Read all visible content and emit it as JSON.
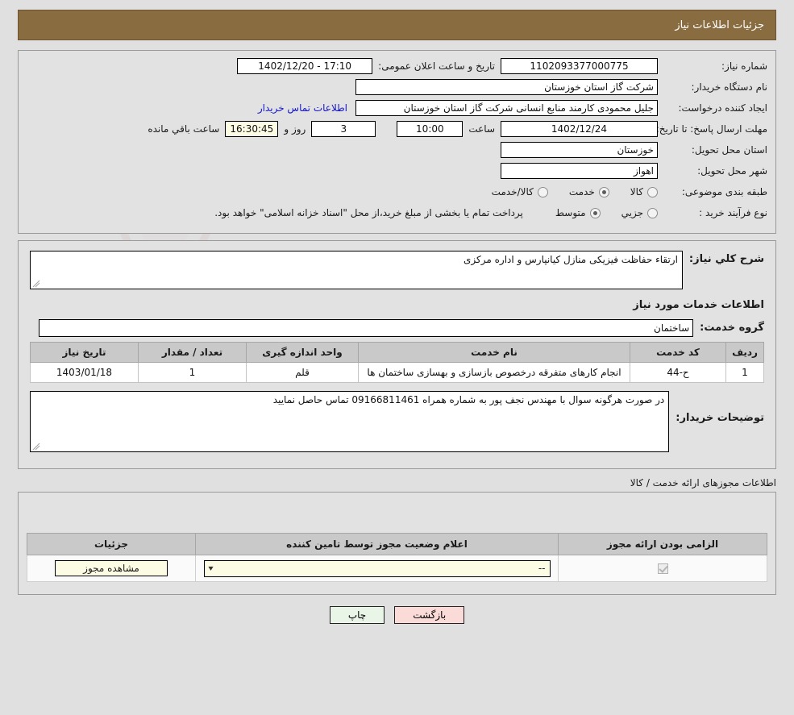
{
  "header": {
    "title": "جزئیات اطلاعات نیاز",
    "bar_color": "#8a6c41"
  },
  "top_form": {
    "need_number_label": "شماره نیاز:",
    "need_number_value": "1102093377000775",
    "announce_label": "تاریخ و ساعت اعلان عمومی:",
    "announce_value": "17:10 - 1402/12/20",
    "buyer_org_label": "نام دستگاه خریدار:",
    "buyer_org_value": "شرکت گاز استان خوزستان",
    "creator_label": "ایجاد کننده درخواست:",
    "creator_value": "جلیل محمودی کارمند منابع انسانی شرکت گاز استان خوزستان",
    "contact_link": "اطلاعات تماس خریدار",
    "deadline_label": "مهلت ارسال پاسخ: تا تاریخ:",
    "deadline_date": "1402/12/24",
    "hour_label": "ساعت",
    "deadline_time": "10:00",
    "days_value": "3",
    "days_label": "روز و",
    "hours_remaining": "16:30:45",
    "remaining_label": "ساعت باقي مانده",
    "province_label": "استان محل تحویل:",
    "province_value": "خوزستان",
    "city_label": "شهر محل تحویل:",
    "city_value": "اهواز",
    "category_label": "طبقه بندی موضوعی:",
    "category_options": [
      {
        "label": "کالا",
        "selected": false
      },
      {
        "label": "خدمت",
        "selected": true
      },
      {
        "label": "کالا/خدمت",
        "selected": false
      }
    ],
    "process_label": "نوع فرآیند خرید :",
    "process_options": [
      {
        "label": "جزیي",
        "selected": false
      },
      {
        "label": "متوسط",
        "selected": true
      }
    ],
    "payment_note": "پرداخت تمام یا بخشی از مبلغ خرید،از محل \"اسناد خزانه اسلامی\" خواهد بود."
  },
  "description": {
    "need_summary_label": "شرح کلي نیاز:",
    "need_summary_value": "ارتقاء حفاظت فیزیکی منازل کیانپارس و اداره مرکزی",
    "services_section_title": "اطلاعات خدمات مورد نیاز",
    "service_group_label": "گروه خدمت:",
    "service_group_value": "ساختمان"
  },
  "items_table": {
    "columns": [
      "ردیف",
      "کد خدمت",
      "نام خدمت",
      "واحد اندازه گیری",
      "تعداد / مقدار",
      "تاریخ نیاز"
    ],
    "rows": [
      {
        "row_no": "1",
        "service_code": "ح-44",
        "service_name": "انجام کارهای متفرقه درخصوص بازسازی و بهسازی ساختمان ها",
        "unit": "قلم",
        "quantity": "1",
        "need_date": "1403/01/18"
      }
    ]
  },
  "buyer_notes": {
    "label": "توضیحات خریدار:",
    "value": "در صورت هرگونه سوال با مهندس نجف پور به شماره همراه 09166811461 تماس حاصل نمایید"
  },
  "permits": {
    "caption": "اطلاعات مجوزهای ارائه خدمت / کالا",
    "columns": [
      "الزامی بودن ارائه مجوز",
      "اعلام وضعیت مجوز توسط تامین کننده",
      "جزئیات"
    ],
    "rows": [
      {
        "required_checked": true,
        "status_value": "--",
        "details_button": "مشاهده مجوز"
      }
    ]
  },
  "footer": {
    "back_button": "بازگشت",
    "print_button": "چاپ"
  },
  "watermark": {
    "text": "AnaTender.net"
  }
}
